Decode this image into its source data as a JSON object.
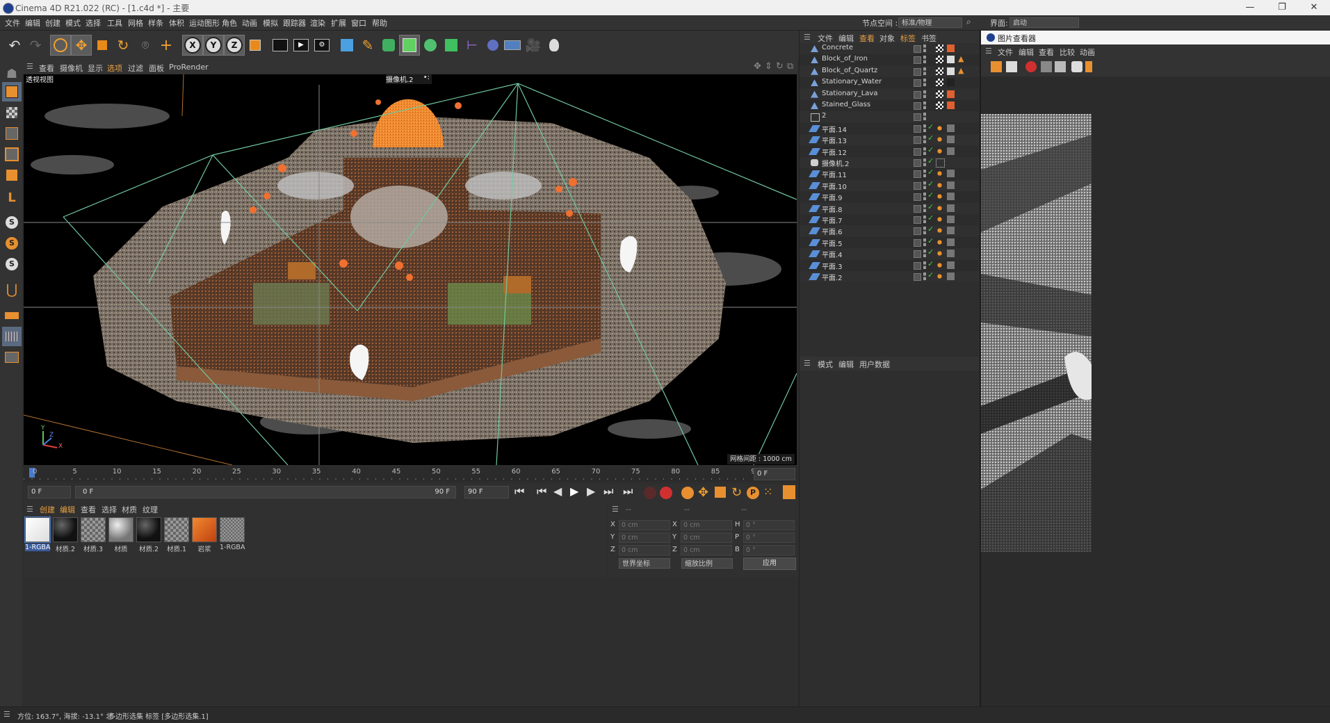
{
  "titlebar": {
    "title": "Cinema 4D R21.022 (RC) - [1.c4d *] - 主要",
    "minimize": "—",
    "restore": "❐",
    "close": "✕"
  },
  "menubar": {
    "items": [
      "文件",
      "编辑",
      "创建",
      "模式",
      "选择",
      "工具",
      "网格",
      "样条",
      "体积",
      "运动图形",
      "角色",
      "动画",
      "模拟",
      "跟踪器",
      "渲染",
      "扩展",
      "窗口",
      "帮助"
    ],
    "node_space_label": "节点空间 :",
    "node_space_value": "标准/物理",
    "interface_label": "界面:",
    "interface_value": "启动"
  },
  "viewport": {
    "menu": [
      "查看",
      "摄像机",
      "显示",
      "选项",
      "过滤",
      "面板",
      "ProRender"
    ],
    "view_name": "透视视图",
    "camera_name": "摄像机.2",
    "grid_spacing": "网格间距 : 1000 cm",
    "axis_labels": {
      "x": "X",
      "y": "Y",
      "z": "Z"
    }
  },
  "timeline": {
    "ticks": [
      "0",
      "5",
      "10",
      "15",
      "20",
      "25",
      "30",
      "35",
      "40",
      "45",
      "50",
      "55",
      "60",
      "65",
      "70",
      "75",
      "80",
      "85",
      "90"
    ],
    "current_frame": "0 F",
    "start_frame": "0 F",
    "range_start": "0 F",
    "range_end": "90 F",
    "end_frame": "90 F"
  },
  "objects": {
    "menu": [
      "文件",
      "编辑",
      "查看",
      "对象",
      "标签",
      "书签"
    ],
    "rows": [
      {
        "name": "Concrete",
        "type": "material"
      },
      {
        "name": "Block_of_Iron",
        "type": "material"
      },
      {
        "name": "Block_of_Quartz",
        "type": "material"
      },
      {
        "name": "Stationary_Water",
        "type": "material"
      },
      {
        "name": "Stationary_Lava",
        "type": "material"
      },
      {
        "name": "Stained_Glass",
        "type": "material"
      },
      {
        "name": "2",
        "type": "group"
      },
      {
        "name": "平面.14",
        "type": "plane"
      },
      {
        "name": "平面.13",
        "type": "plane"
      },
      {
        "name": "平面.12",
        "type": "plane"
      },
      {
        "name": "摄像机.2",
        "type": "camera"
      },
      {
        "name": "平面.11",
        "type": "plane"
      },
      {
        "name": "平面.10",
        "type": "plane"
      },
      {
        "name": "平面.9",
        "type": "plane"
      },
      {
        "name": "平面.8",
        "type": "plane"
      },
      {
        "name": "平面.7",
        "type": "plane"
      },
      {
        "name": "平面.6",
        "type": "plane"
      },
      {
        "name": "平面.5",
        "type": "plane"
      },
      {
        "name": "平面.4",
        "type": "plane"
      },
      {
        "name": "平面.3",
        "type": "plane"
      },
      {
        "name": "平面.2",
        "type": "plane"
      }
    ]
  },
  "attributes": {
    "menu": [
      "模式",
      "编辑",
      "用户数据"
    ]
  },
  "materials": {
    "menu": [
      "创建",
      "编辑",
      "查看",
      "选择",
      "材质",
      "纹理"
    ],
    "items": [
      {
        "label": "1-RGBA",
        "style": "white"
      },
      {
        "label": "材质.2",
        "style": "black"
      },
      {
        "label": "材质.3",
        "style": "checker"
      },
      {
        "label": "材质",
        "style": "grey"
      },
      {
        "label": "材质.2",
        "style": "black"
      },
      {
        "label": "材质.1",
        "style": "checker"
      },
      {
        "label": "岩浆",
        "style": "lava"
      },
      {
        "label": "1-RGBA",
        "style": "rock"
      }
    ]
  },
  "coords": {
    "header": [
      "--",
      "--",
      "--"
    ],
    "rows": [
      {
        "a": "X",
        "av": "0 cm",
        "b": "X",
        "bv": "0 cm",
        "c": "H",
        "cv": "0 °"
      },
      {
        "a": "Y",
        "av": "0 cm",
        "b": "Y",
        "bv": "0 cm",
        "c": "P",
        "cv": "0 °"
      },
      {
        "a": "Z",
        "av": "0 cm",
        "b": "Z",
        "bv": "0 cm",
        "c": "B",
        "cv": "0 °"
      }
    ],
    "world": "世界坐标",
    "scale": "缩放比例",
    "apply": "应用"
  },
  "picture_viewer": {
    "title": "图片查看器",
    "menu": [
      "文件",
      "编辑",
      "查看",
      "比较",
      "动画"
    ]
  },
  "status": {
    "text1": "方位: 163.7°, 海拔: -13.1° 北",
    "text2": "多边形选集 标签 [多边形选集.1]"
  }
}
